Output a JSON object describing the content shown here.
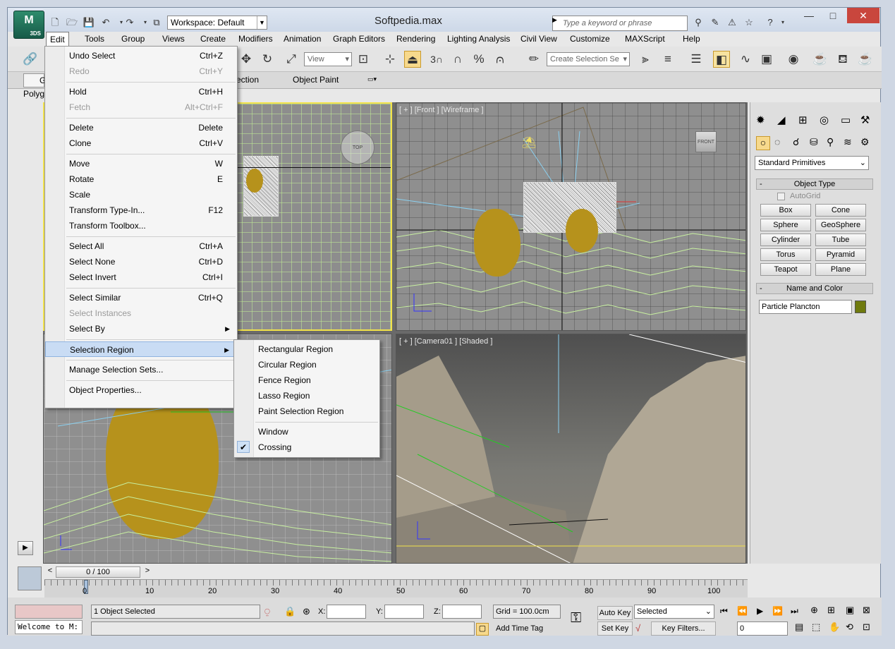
{
  "window": {
    "title": "Softpedia.max",
    "app_logo": "3DS",
    "workspace": "Workspace: Default",
    "search_placeholder": "Type a keyword or phrase",
    "minimize": "—",
    "maximize": "□",
    "close": "✕"
  },
  "menubar": [
    "Edit",
    "Tools",
    "Group",
    "Views",
    "Create",
    "Modifiers",
    "Animation",
    "Graph Editors",
    "Rendering",
    "Lighting Analysis",
    "Civil View",
    "Customize",
    "MAXScript",
    "Help"
  ],
  "toolbar": {
    "view_dropdown": "View",
    "selection_set_placeholder": "Create Selection Se",
    "snap_value": "3"
  },
  "ribbon": {
    "tab1": "ection",
    "tab2": "Object Paint",
    "left1": "G",
    "left2": "Polyg"
  },
  "edit_menu": [
    {
      "label": "Undo Select",
      "shortcut": "Ctrl+Z",
      "enabled": true
    },
    {
      "label": "Redo",
      "shortcut": "Ctrl+Y",
      "enabled": false
    },
    {
      "label": "Hold",
      "shortcut": "Ctrl+H",
      "enabled": true
    },
    {
      "label": "Fetch",
      "shortcut": "Alt+Ctrl+F",
      "enabled": false
    },
    {
      "label": "Delete",
      "shortcut": "Delete",
      "enabled": true
    },
    {
      "label": "Clone",
      "shortcut": "Ctrl+V",
      "enabled": true
    },
    {
      "label": "Move",
      "shortcut": "W",
      "enabled": true
    },
    {
      "label": "Rotate",
      "shortcut": "E",
      "enabled": true
    },
    {
      "label": "Scale",
      "shortcut": "",
      "enabled": true
    },
    {
      "label": "Transform Type-In...",
      "shortcut": "F12",
      "enabled": true
    },
    {
      "label": "Transform Toolbox...",
      "shortcut": "",
      "enabled": true
    },
    {
      "label": "Select All",
      "shortcut": "Ctrl+A",
      "enabled": true
    },
    {
      "label": "Select None",
      "shortcut": "Ctrl+D",
      "enabled": true
    },
    {
      "label": "Select Invert",
      "shortcut": "Ctrl+I",
      "enabled": true
    },
    {
      "label": "Select Similar",
      "shortcut": "Ctrl+Q",
      "enabled": true
    },
    {
      "label": "Select Instances",
      "shortcut": "",
      "enabled": false
    },
    {
      "label": "Select By",
      "shortcut": "",
      "enabled": true,
      "submenu": true
    },
    {
      "label": "Selection Region",
      "shortcut": "",
      "enabled": true,
      "submenu": true,
      "highlighted": true
    },
    {
      "label": "Manage Selection Sets...",
      "shortcut": "",
      "enabled": true
    },
    {
      "label": "Object Properties...",
      "shortcut": "",
      "enabled": true
    }
  ],
  "selection_region_menu": [
    {
      "label": "Rectangular Region",
      "checked": false
    },
    {
      "label": "Circular Region",
      "checked": false
    },
    {
      "label": "Fence Region",
      "checked": false
    },
    {
      "label": "Lasso Region",
      "checked": false
    },
    {
      "label": "Paint Selection Region",
      "checked": false
    },
    {
      "label": "Window",
      "checked": false
    },
    {
      "label": "Crossing",
      "checked": true
    }
  ],
  "viewports": {
    "top": {
      "nav_cube": "TOP"
    },
    "front": {
      "label": "[ + ] [Front ] [Wireframe ]",
      "nav_cube": "FRONT"
    },
    "camera": {
      "label": "[ + ] [Camera01 ] [Shaded ]"
    },
    "accent_color": "#f2e24a"
  },
  "command_panel": {
    "category_dropdown": "Standard Primitives",
    "object_type_title": "Object Type",
    "autogrid": "AutoGrid",
    "primitives": [
      "Box",
      "Cone",
      "Sphere",
      "GeoSphere",
      "Cylinder",
      "Tube",
      "Torus",
      "Pyramid",
      "Teapot",
      "Plane"
    ],
    "name_color_title": "Name and Color",
    "object_name": "Particle Plancton",
    "object_color": "#6f7a0e",
    "collapse_sign": "-"
  },
  "timeline": {
    "frame": "0 / 100",
    "prev": "<",
    "next": ">",
    "ticks": [
      "0",
      "10",
      "20",
      "30",
      "40",
      "50",
      "60",
      "70",
      "80",
      "90",
      "100"
    ]
  },
  "status": {
    "selection": "1 Object Selected",
    "x_label": "X:",
    "y_label": "Y:",
    "z_label": "Z:",
    "grid": "Grid = 100.0cm",
    "add_time_tag": "Add Time Tag",
    "auto_key": "Auto Key",
    "set_key": "Set Key",
    "key_mode": "Selected",
    "key_filters": "Key Filters...",
    "current_frame": "0",
    "maxscript_listener": "Welcome to M:"
  }
}
